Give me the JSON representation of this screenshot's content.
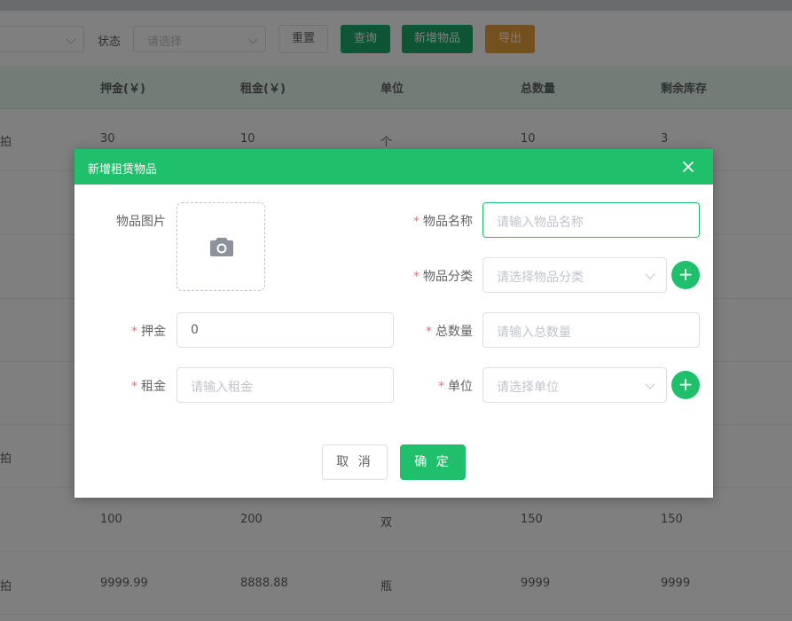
{
  "filters": {
    "status_label": "状态",
    "status_placeholder": "请选择",
    "reset_label": "重置",
    "query_label": "查询",
    "add_label": "新增物品",
    "export_label": "导出"
  },
  "table": {
    "headers": [
      "押金(￥)",
      "租金(￥)",
      "单位",
      "总数量",
      "剩余库存"
    ],
    "rows": [
      {
        "left": "拍",
        "cells": [
          "30",
          "10",
          "个",
          "10",
          "3"
        ]
      },
      {
        "left": "",
        "cells": [
          "",
          "",
          "",
          "",
          ""
        ]
      },
      {
        "left": "",
        "cells": [
          "",
          "",
          "",
          "",
          ""
        ]
      },
      {
        "left": "",
        "cells": [
          "",
          "",
          "",
          "",
          ""
        ]
      },
      {
        "left": "拍",
        "cells": [
          "",
          "",
          "",
          "",
          ""
        ]
      },
      {
        "left": "",
        "cells": [
          "100",
          "200",
          "双",
          "150",
          "150"
        ]
      },
      {
        "left": "拍",
        "cells": [
          "9999.99",
          "8888.88",
          "瓶",
          "9999",
          "9999"
        ]
      }
    ]
  },
  "dialog": {
    "title": "新增租赁物品",
    "image_label": "物品图片",
    "name_label": "物品名称",
    "name_placeholder": "请输入物品名称",
    "category_label": "物品分类",
    "category_placeholder": "请选择物品分类",
    "deposit_label": "押金",
    "deposit_value": "0",
    "total_label": "总数量",
    "total_placeholder": "请输入总数量",
    "rent_label": "租金",
    "rent_placeholder": "请输入租金",
    "unit_label": "单位",
    "unit_placeholder": "请选择单位",
    "cancel_label": "取 消",
    "confirm_label": "确 定",
    "required_mark": "*",
    "plus_glyph": "+"
  },
  "colors": {
    "primary": "#20bf6b",
    "warning": "#e6a23c",
    "required": "#f56c6c"
  }
}
